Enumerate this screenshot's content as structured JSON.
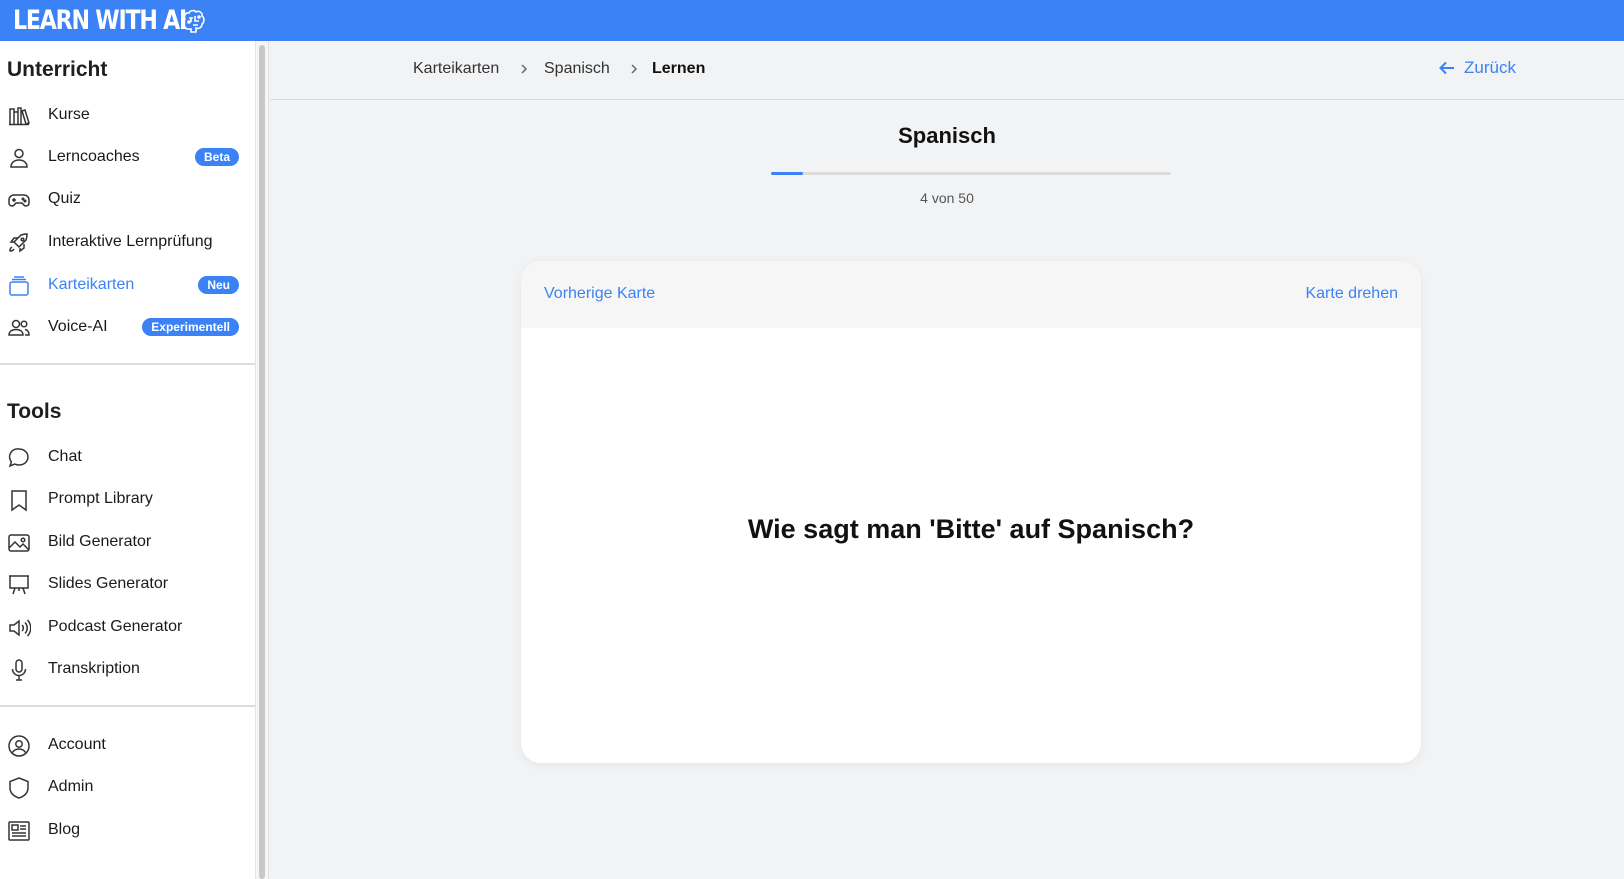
{
  "app": {
    "logo_text": "LEARN WITH AI",
    "accent": "#3b82f6"
  },
  "sidebar": {
    "section_unterricht": "Unterricht",
    "section_tools": "Tools",
    "unterricht_items": [
      {
        "label": "Kurse",
        "icon": "books-icon"
      },
      {
        "label": "Lerncoaches",
        "icon": "user-icon",
        "badge": "Beta"
      },
      {
        "label": "Quiz",
        "icon": "gamepad-icon"
      },
      {
        "label": "Interaktive Lernprüfung",
        "icon": "rocket-icon"
      },
      {
        "label": "Karteikarten",
        "icon": "cards-icon",
        "badge": "Neu",
        "active": true
      },
      {
        "label": "Voice-AI",
        "icon": "users-icon",
        "badge": "Experimentell"
      }
    ],
    "tools_items": [
      {
        "label": "Chat",
        "icon": "chat-icon"
      },
      {
        "label": "Prompt Library",
        "icon": "bookmark-icon"
      },
      {
        "label": "Bild Generator",
        "icon": "image-icon"
      },
      {
        "label": "Slides Generator",
        "icon": "presentation-icon"
      },
      {
        "label": "Podcast Generator",
        "icon": "speaker-icon"
      },
      {
        "label": "Transkription",
        "icon": "microphone-icon"
      }
    ],
    "account_items": [
      {
        "label": "Account",
        "icon": "account-icon"
      },
      {
        "label": "Admin",
        "icon": "shield-icon"
      },
      {
        "label": "Blog",
        "icon": "newspaper-icon"
      }
    ]
  },
  "breadcrumb": {
    "items": [
      "Karteikarten",
      "Spanisch",
      "Lernen"
    ]
  },
  "back_label": "Zurück",
  "deck": {
    "title": "Spanisch",
    "progress_text": "4 von 50",
    "current": 4,
    "total": 50
  },
  "card": {
    "prev_label": "Vorherige Karte",
    "flip_label": "Karte drehen",
    "question": "Wie sagt man 'Bitte' auf Spanisch?"
  }
}
